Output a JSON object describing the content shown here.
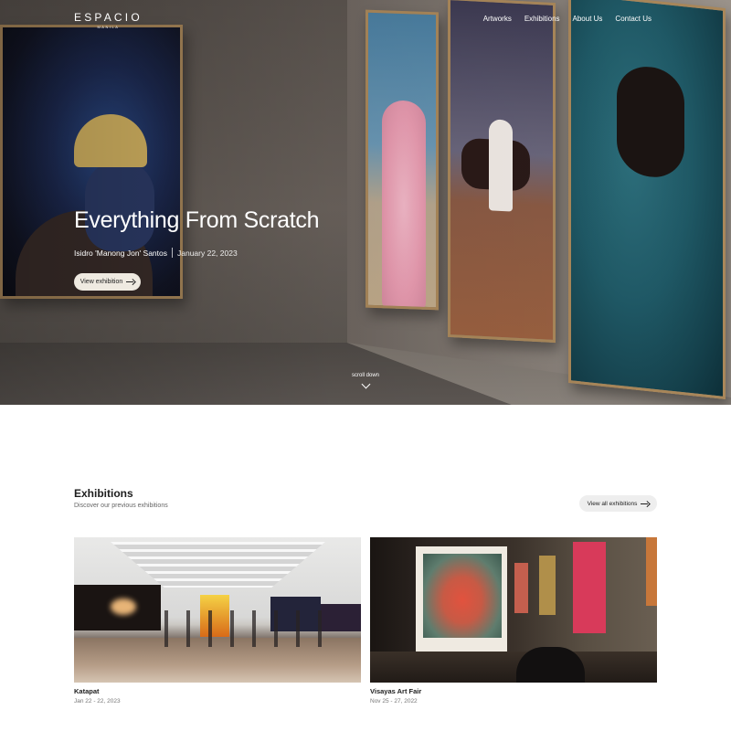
{
  "header": {
    "logo": "ESPACIO",
    "logo_sub": "MANILA",
    "nav": [
      "Artworks",
      "Exhibitions",
      "About Us",
      "Contact Us"
    ]
  },
  "hero": {
    "title": "Everything From Scratch",
    "artist": "Isidro 'Manong Jon' Santos",
    "date": "January 22, 2023",
    "button_label": "View exhibition",
    "scroll_label": "scroll down"
  },
  "exhibitions": {
    "title": "Exhibitions",
    "subtitle": "Discover our previous exhibitions",
    "view_all_label": "View all exhibitions",
    "items": [
      {
        "name": "Katapat",
        "date": "Jan 22 - 22, 2023"
      },
      {
        "name": "Visayas Art Fair",
        "date": "Nov 25 - 27, 2022"
      }
    ]
  },
  "colors": {
    "button_bg": "#efeae1",
    "view_all_bg": "#eeeeee",
    "frame": "#a9875a"
  }
}
